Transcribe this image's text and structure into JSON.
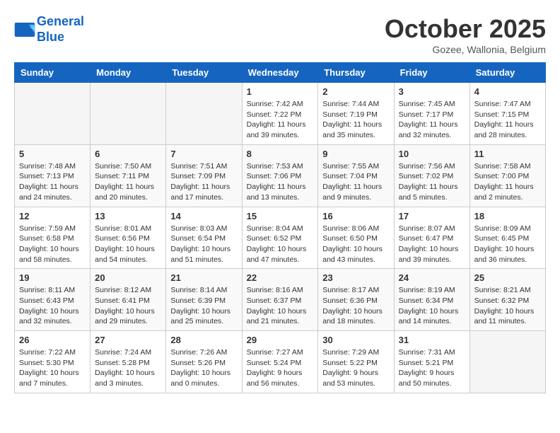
{
  "header": {
    "logo_line1": "General",
    "logo_line2": "Blue",
    "month": "October 2025",
    "location": "Gozee, Wallonia, Belgium"
  },
  "weekdays": [
    "Sunday",
    "Monday",
    "Tuesday",
    "Wednesday",
    "Thursday",
    "Friday",
    "Saturday"
  ],
  "weeks": [
    [
      {
        "day": "",
        "text": ""
      },
      {
        "day": "",
        "text": ""
      },
      {
        "day": "",
        "text": ""
      },
      {
        "day": "1",
        "text": "Sunrise: 7:42 AM\nSunset: 7:22 PM\nDaylight: 11 hours\nand 39 minutes."
      },
      {
        "day": "2",
        "text": "Sunrise: 7:44 AM\nSunset: 7:19 PM\nDaylight: 11 hours\nand 35 minutes."
      },
      {
        "day": "3",
        "text": "Sunrise: 7:45 AM\nSunset: 7:17 PM\nDaylight: 11 hours\nand 32 minutes."
      },
      {
        "day": "4",
        "text": "Sunrise: 7:47 AM\nSunset: 7:15 PM\nDaylight: 11 hours\nand 28 minutes."
      }
    ],
    [
      {
        "day": "5",
        "text": "Sunrise: 7:48 AM\nSunset: 7:13 PM\nDaylight: 11 hours\nand 24 minutes."
      },
      {
        "day": "6",
        "text": "Sunrise: 7:50 AM\nSunset: 7:11 PM\nDaylight: 11 hours\nand 20 minutes."
      },
      {
        "day": "7",
        "text": "Sunrise: 7:51 AM\nSunset: 7:09 PM\nDaylight: 11 hours\nand 17 minutes."
      },
      {
        "day": "8",
        "text": "Sunrise: 7:53 AM\nSunset: 7:06 PM\nDaylight: 11 hours\nand 13 minutes."
      },
      {
        "day": "9",
        "text": "Sunrise: 7:55 AM\nSunset: 7:04 PM\nDaylight: 11 hours\nand 9 minutes."
      },
      {
        "day": "10",
        "text": "Sunrise: 7:56 AM\nSunset: 7:02 PM\nDaylight: 11 hours\nand 5 minutes."
      },
      {
        "day": "11",
        "text": "Sunrise: 7:58 AM\nSunset: 7:00 PM\nDaylight: 11 hours\nand 2 minutes."
      }
    ],
    [
      {
        "day": "12",
        "text": "Sunrise: 7:59 AM\nSunset: 6:58 PM\nDaylight: 10 hours\nand 58 minutes."
      },
      {
        "day": "13",
        "text": "Sunrise: 8:01 AM\nSunset: 6:56 PM\nDaylight: 10 hours\nand 54 minutes."
      },
      {
        "day": "14",
        "text": "Sunrise: 8:03 AM\nSunset: 6:54 PM\nDaylight: 10 hours\nand 51 minutes."
      },
      {
        "day": "15",
        "text": "Sunrise: 8:04 AM\nSunset: 6:52 PM\nDaylight: 10 hours\nand 47 minutes."
      },
      {
        "day": "16",
        "text": "Sunrise: 8:06 AM\nSunset: 6:50 PM\nDaylight: 10 hours\nand 43 minutes."
      },
      {
        "day": "17",
        "text": "Sunrise: 8:07 AM\nSunset: 6:47 PM\nDaylight: 10 hours\nand 39 minutes."
      },
      {
        "day": "18",
        "text": "Sunrise: 8:09 AM\nSunset: 6:45 PM\nDaylight: 10 hours\nand 36 minutes."
      }
    ],
    [
      {
        "day": "19",
        "text": "Sunrise: 8:11 AM\nSunset: 6:43 PM\nDaylight: 10 hours\nand 32 minutes."
      },
      {
        "day": "20",
        "text": "Sunrise: 8:12 AM\nSunset: 6:41 PM\nDaylight: 10 hours\nand 29 minutes."
      },
      {
        "day": "21",
        "text": "Sunrise: 8:14 AM\nSunset: 6:39 PM\nDaylight: 10 hours\nand 25 minutes."
      },
      {
        "day": "22",
        "text": "Sunrise: 8:16 AM\nSunset: 6:37 PM\nDaylight: 10 hours\nand 21 minutes."
      },
      {
        "day": "23",
        "text": "Sunrise: 8:17 AM\nSunset: 6:36 PM\nDaylight: 10 hours\nand 18 minutes."
      },
      {
        "day": "24",
        "text": "Sunrise: 8:19 AM\nSunset: 6:34 PM\nDaylight: 10 hours\nand 14 minutes."
      },
      {
        "day": "25",
        "text": "Sunrise: 8:21 AM\nSunset: 6:32 PM\nDaylight: 10 hours\nand 11 minutes."
      }
    ],
    [
      {
        "day": "26",
        "text": "Sunrise: 7:22 AM\nSunset: 5:30 PM\nDaylight: 10 hours\nand 7 minutes."
      },
      {
        "day": "27",
        "text": "Sunrise: 7:24 AM\nSunset: 5:28 PM\nDaylight: 10 hours\nand 3 minutes."
      },
      {
        "day": "28",
        "text": "Sunrise: 7:26 AM\nSunset: 5:26 PM\nDaylight: 10 hours\nand 0 minutes."
      },
      {
        "day": "29",
        "text": "Sunrise: 7:27 AM\nSunset: 5:24 PM\nDaylight: 9 hours\nand 56 minutes."
      },
      {
        "day": "30",
        "text": "Sunrise: 7:29 AM\nSunset: 5:22 PM\nDaylight: 9 hours\nand 53 minutes."
      },
      {
        "day": "31",
        "text": "Sunrise: 7:31 AM\nSunset: 5:21 PM\nDaylight: 9 hours\nand 50 minutes."
      },
      {
        "day": "",
        "text": ""
      }
    ]
  ]
}
